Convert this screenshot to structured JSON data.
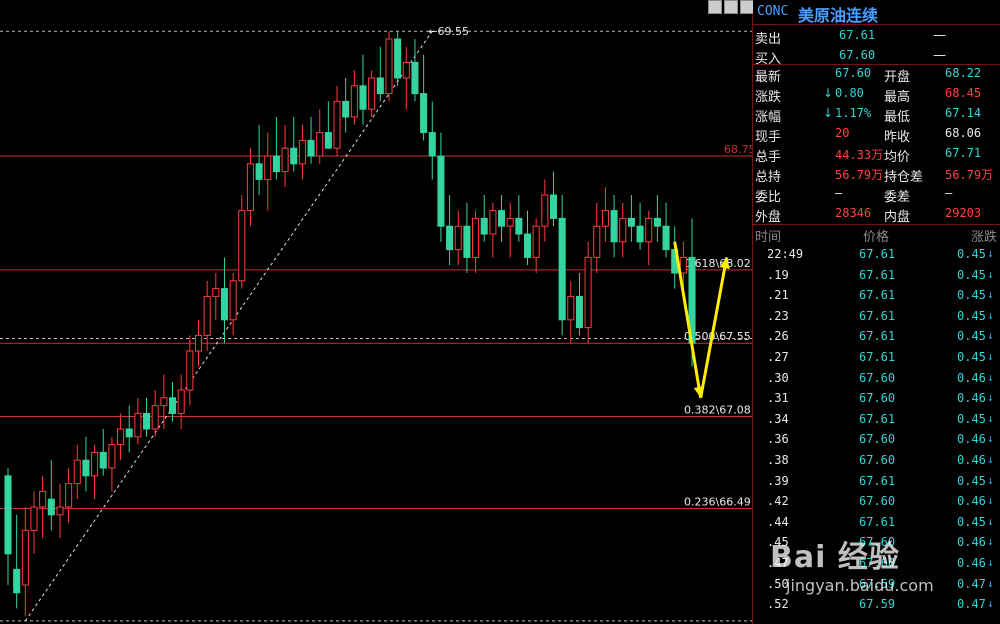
{
  "header": {
    "code": "CONC",
    "name": "美原油连续"
  },
  "quote": {
    "sell": {
      "label": "卖出",
      "price": "67.61",
      "vol": "—"
    },
    "buy": {
      "label": "买入",
      "price": "67.60",
      "vol": "—"
    },
    "rows": [
      {
        "l1": "最新",
        "v1": "67.60",
        "c1": "grn",
        "l2": "开盘",
        "v2": "68.22",
        "c2": "grn",
        "arrow": ""
      },
      {
        "l1": "涨跌",
        "v1": "0.80",
        "c1": "grn",
        "l2": "最高",
        "v2": "68.45",
        "c2": "red",
        "arrow": "↓"
      },
      {
        "l1": "涨幅",
        "v1": "1.17%",
        "c1": "grn",
        "l2": "最低",
        "v2": "67.14",
        "c2": "grn",
        "arrow": "↓"
      },
      {
        "l1": "现手",
        "v1": "20",
        "c1": "red",
        "l2": "昨收",
        "v2": "68.06",
        "c2": "wht",
        "arrow": ""
      },
      {
        "l1": "总手",
        "v1": "44.33万",
        "c1": "red",
        "l2": "均价",
        "v2": "67.71",
        "c2": "grn",
        "arrow": ""
      },
      {
        "l1": "总持",
        "v1": "56.79万",
        "c1": "red",
        "l2": "持仓差",
        "v2": "56.79万",
        "c2": "red",
        "arrow": ""
      },
      {
        "l1": "委比",
        "v1": "—",
        "c1": "wht",
        "l2": "委差",
        "v2": "—",
        "c2": "wht",
        "arrow": ""
      },
      {
        "l1": "外盘",
        "v1": "28346",
        "c1": "red",
        "l2": "内盘",
        "v2": "29203",
        "c2": "red",
        "arrow": ""
      }
    ]
  },
  "ticks_header": {
    "time": "时间",
    "price": "价格",
    "change": "涨跌"
  },
  "ticks": [
    {
      "t": "22:49",
      "p": "67.61",
      "c": "0.45"
    },
    {
      "t": ".19",
      "p": "67.61",
      "c": "0.45"
    },
    {
      "t": ".21",
      "p": "67.61",
      "c": "0.45"
    },
    {
      "t": ".23",
      "p": "67.61",
      "c": "0.45"
    },
    {
      "t": ".26",
      "p": "67.61",
      "c": "0.45"
    },
    {
      "t": ".27",
      "p": "67.61",
      "c": "0.45"
    },
    {
      "t": ".30",
      "p": "67.60",
      "c": "0.46"
    },
    {
      "t": ".31",
      "p": "67.60",
      "c": "0.46"
    },
    {
      "t": ".34",
      "p": "67.61",
      "c": "0.45"
    },
    {
      "t": ".36",
      "p": "67.60",
      "c": "0.46"
    },
    {
      "t": ".38",
      "p": "67.60",
      "c": "0.46"
    },
    {
      "t": ".39",
      "p": "67.61",
      "c": "0.45"
    },
    {
      "t": ".42",
      "p": "67.60",
      "c": "0.46"
    },
    {
      "t": ".44",
      "p": "67.61",
      "c": "0.45"
    },
    {
      "t": ".45",
      "p": "67.60",
      "c": "0.46"
    },
    {
      "t": ".47",
      "p": "67.60",
      "c": "0.46"
    },
    {
      "t": ".50",
      "p": "67.59",
      "c": "0.47"
    },
    {
      "t": ".52",
      "p": "67.59",
      "c": "0.47"
    }
  ],
  "chart_data": {
    "type": "candlestick",
    "ylim": [
      65.75,
      69.75
    ],
    "high_label": "69.55",
    "fib_levels": [
      {
        "value": 68.75,
        "label": "68.75",
        "style": "solid"
      },
      {
        "value": 68.02,
        "label": "0.618\\68.02",
        "style": "solid"
      },
      {
        "value": 67.55,
        "label": "0.500\\67.55",
        "style": "solid"
      },
      {
        "value": 67.08,
        "label": "0.382\\67.08",
        "style": "solid"
      },
      {
        "value": 66.49,
        "label": "0.236\\66.49",
        "style": "solid"
      }
    ],
    "dashed_levels": [
      69.55,
      65.77,
      67.58
    ],
    "trend_line": {
      "from": {
        "i": 2,
        "v": 65.77
      },
      "to": {
        "i": 49,
        "v": 69.55
      }
    },
    "candles": [
      [
        66.7,
        66.75,
        66.0,
        66.2
      ],
      [
        66.1,
        66.45,
        65.85,
        65.95
      ],
      [
        66.0,
        66.5,
        65.8,
        66.35
      ],
      [
        66.35,
        66.6,
        66.2,
        66.5
      ],
      [
        66.5,
        66.7,
        66.3,
        66.6
      ],
      [
        66.55,
        66.8,
        66.35,
        66.45
      ],
      [
        66.45,
        66.65,
        66.3,
        66.5
      ],
      [
        66.5,
        66.75,
        66.4,
        66.65
      ],
      [
        66.65,
        66.9,
        66.55,
        66.8
      ],
      [
        66.8,
        66.95,
        66.6,
        66.7
      ],
      [
        66.7,
        66.9,
        66.55,
        66.85
      ],
      [
        66.85,
        67.0,
        66.7,
        66.75
      ],
      [
        66.75,
        66.95,
        66.6,
        66.9
      ],
      [
        66.9,
        67.1,
        66.8,
        67.0
      ],
      [
        67.0,
        67.15,
        66.85,
        66.95
      ],
      [
        66.95,
        67.2,
        66.9,
        67.1
      ],
      [
        67.1,
        67.2,
        66.95,
        67.0
      ],
      [
        67.0,
        67.25,
        66.95,
        67.15
      ],
      [
        67.15,
        67.35,
        67.0,
        67.2
      ],
      [
        67.2,
        67.3,
        67.05,
        67.1
      ],
      [
        67.1,
        67.35,
        67.0,
        67.25
      ],
      [
        67.25,
        67.6,
        67.15,
        67.5
      ],
      [
        67.5,
        67.7,
        67.4,
        67.6
      ],
      [
        67.6,
        67.95,
        67.5,
        67.85
      ],
      [
        67.85,
        68.0,
        67.7,
        67.9
      ],
      [
        67.9,
        68.1,
        67.55,
        67.7
      ],
      [
        67.7,
        68.0,
        67.6,
        67.95
      ],
      [
        67.95,
        68.5,
        67.9,
        68.4
      ],
      [
        68.4,
        68.8,
        68.3,
        68.7
      ],
      [
        68.7,
        68.95,
        68.5,
        68.6
      ],
      [
        68.6,
        68.9,
        68.4,
        68.75
      ],
      [
        68.75,
        69.0,
        68.6,
        68.65
      ],
      [
        68.65,
        68.95,
        68.55,
        68.8
      ],
      [
        68.8,
        69.0,
        68.65,
        68.7
      ],
      [
        68.7,
        68.95,
        68.6,
        68.85
      ],
      [
        68.85,
        69.0,
        68.7,
        68.75
      ],
      [
        68.75,
        69.05,
        68.7,
        68.9
      ],
      [
        68.9,
        69.1,
        68.8,
        68.8
      ],
      [
        68.8,
        69.2,
        68.75,
        69.1
      ],
      [
        69.1,
        69.25,
        68.9,
        69.0
      ],
      [
        69.0,
        69.3,
        68.95,
        69.2
      ],
      [
        69.2,
        69.4,
        68.95,
        69.05
      ],
      [
        69.05,
        69.3,
        69.0,
        69.25
      ],
      [
        69.25,
        69.45,
        69.1,
        69.15
      ],
      [
        69.15,
        69.55,
        69.1,
        69.5
      ],
      [
        69.5,
        69.55,
        69.2,
        69.25
      ],
      [
        69.25,
        69.45,
        69.05,
        69.35
      ],
      [
        69.35,
        69.5,
        69.1,
        69.15
      ],
      [
        69.15,
        69.4,
        68.85,
        68.9
      ],
      [
        68.9,
        69.1,
        68.6,
        68.75
      ],
      [
        68.75,
        68.9,
        68.2,
        68.3
      ],
      [
        68.3,
        68.5,
        68.05,
        68.15
      ],
      [
        68.15,
        68.4,
        68.05,
        68.3
      ],
      [
        68.3,
        68.45,
        68.0,
        68.1
      ],
      [
        68.1,
        68.4,
        68.0,
        68.35
      ],
      [
        68.35,
        68.5,
        68.2,
        68.25
      ],
      [
        68.25,
        68.45,
        68.1,
        68.4
      ],
      [
        68.4,
        68.5,
        68.2,
        68.3
      ],
      [
        68.3,
        68.45,
        68.1,
        68.35
      ],
      [
        68.35,
        68.5,
        68.2,
        68.25
      ],
      [
        68.25,
        68.4,
        68.05,
        68.1
      ],
      [
        68.1,
        68.35,
        68.0,
        68.3
      ],
      [
        68.3,
        68.6,
        68.2,
        68.5
      ],
      [
        68.5,
        68.65,
        68.3,
        68.35
      ],
      [
        68.35,
        68.5,
        67.6,
        67.7
      ],
      [
        67.7,
        67.95,
        67.55,
        67.85
      ],
      [
        67.85,
        68.0,
        67.6,
        67.65
      ],
      [
        67.65,
        68.2,
        67.55,
        68.1
      ],
      [
        68.1,
        68.45,
        68.0,
        68.3
      ],
      [
        68.3,
        68.55,
        68.2,
        68.4
      ],
      [
        68.4,
        68.5,
        68.1,
        68.2
      ],
      [
        68.2,
        68.45,
        68.1,
        68.35
      ],
      [
        68.35,
        68.5,
        68.2,
        68.3
      ],
      [
        68.3,
        68.45,
        68.15,
        68.2
      ],
      [
        68.2,
        68.4,
        68.05,
        68.35
      ],
      [
        68.35,
        68.5,
        68.2,
        68.3
      ],
      [
        68.3,
        68.45,
        68.1,
        68.15
      ],
      [
        68.15,
        68.3,
        67.9,
        68.0
      ],
      [
        68.0,
        68.2,
        67.85,
        68.1
      ],
      [
        68.1,
        68.35,
        67.4,
        67.55
      ]
    ],
    "arrows": [
      {
        "from": {
          "i": 77,
          "v": 68.2
        },
        "to": {
          "i": 80,
          "v": 67.2
        }
      },
      {
        "from": {
          "i": 80,
          "v": 67.2
        },
        "to": {
          "i": 83,
          "v": 68.1
        }
      }
    ]
  },
  "watermark": {
    "logo": "Bai 经验",
    "url": "jingyan.baidu.com"
  },
  "colors": {
    "up": "#ff3b3b",
    "down": "#33d4a0",
    "level": "#c83232",
    "arrow": "#ffee00"
  }
}
